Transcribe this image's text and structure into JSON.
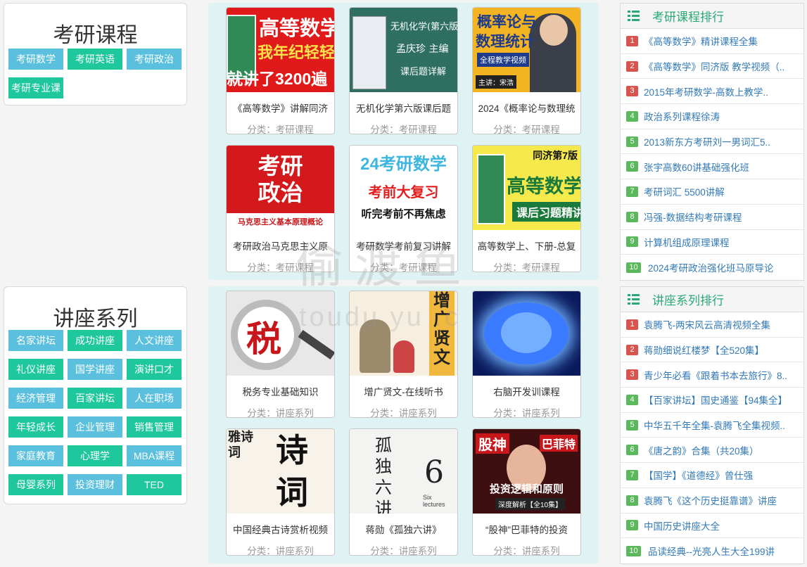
{
  "kaoyan": {
    "title": "考研课程",
    "tags": [
      "考研数学",
      "考研英语",
      "考研政治",
      "考研专业课"
    ],
    "courses": [
      {
        "title": "《高等数学》讲解同济",
        "cat": "分类：考研课程",
        "thumb": [
          "高等数学",
          "我年纪轻轻",
          "就讲了3200遍"
        ]
      },
      {
        "title": "无机化学第六版课后题",
        "cat": "分类：考研课程",
        "thumb": [
          "无机化学(第六版)",
          "孟庆珍 主编",
          "课后题详解"
        ]
      },
      {
        "title": "2024《概率论与数理统",
        "cat": "分类：考研课程",
        "thumb": [
          "概率论与",
          "数理统计",
          "全程教学视频",
          "主讲：宋浩"
        ]
      },
      {
        "title": "考研政治马克思主义原",
        "cat": "分类：考研课程",
        "thumb": [
          "考研",
          "政治",
          "马克思主义基本原理概论"
        ]
      },
      {
        "title": "考研数学考前复习讲解",
        "cat": "分类：考研课程",
        "thumb": [
          "24考研数学",
          "考前大复习",
          "听完考前不再焦虑"
        ]
      },
      {
        "title": "高等数学上、下册-总复",
        "cat": "分类：考研课程",
        "thumb": [
          "同济第7版",
          "高等数学",
          "课后习题精讲"
        ]
      }
    ],
    "rank_title": "考研课程排行",
    "rank": [
      "《高等数学》精讲课程全集",
      "《高等数学》同济版 教学视频（..",
      "2015年考研数学-高数上教学..",
      "政治系列课程徐涛",
      "2013新东方考研刘一男词汇5..",
      "张宇高数60讲基础强化班",
      "考研词汇 5500讲解",
      "冯强-数据结构考研课程",
      "计算机组成原理课程",
      "2024考研政治强化班马原导论"
    ]
  },
  "lecture": {
    "title": "讲座系列",
    "tags": [
      "名家讲坛",
      "成功讲座",
      "人文讲座",
      "礼仪讲座",
      "国学讲座",
      "演讲口才",
      "经济管理",
      "百家讲坛",
      "人在职场",
      "年轻成长",
      "企业管理",
      "销售管理",
      "家庭教育",
      "心理学",
      "MBA课程",
      "母婴系列",
      "投资理财",
      "TED"
    ],
    "courses": [
      {
        "title": "税务专业基础知识",
        "cat": "分类：讲座系列",
        "thumb": [
          "税"
        ]
      },
      {
        "title": "增广贤文-在线听书",
        "cat": "分类：讲座系列",
        "thumb": [
          "增广贤文"
        ]
      },
      {
        "title": "右脑开发训课程",
        "cat": "分类：讲座系列",
        "thumb": []
      },
      {
        "title": "中国经典古诗赏析视频",
        "cat": "分类：讲座系列",
        "thumb": [
          "诗词",
          "雅诗词"
        ]
      },
      {
        "title": "蒋勋《孤独六讲》",
        "cat": "分类：讲座系列",
        "thumb": [
          "孤独六讲",
          "6",
          "Six lectures"
        ]
      },
      {
        "title": "“股神”巴菲特的投资",
        "cat": "分类：讲座系列",
        "thumb": [
          "股神",
          "巴菲特",
          "投资逻辑和原则",
          "深度解析【全10集】"
        ]
      }
    ],
    "rank_title": "讲座系列排行",
    "rank": [
      "袁腾飞-两宋风云高清视频全集",
      "蒋勋细说红楼梦【全520集】",
      "青少年必看《跟着书本去旅行》8..",
      "【百家讲坛】国史通鉴【94集全】",
      "中华五千年全集-袁腾飞全集视频..",
      "《唐之韵》合集（共20集）",
      "【国学】《道德经》曾仕强",
      "袁腾飞《这个历史挺靠谱》讲座",
      "中国历史讲座大全",
      "品读经典--光亮人生大全199讲"
    ]
  },
  "rank_numbers": [
    "1",
    "2",
    "3",
    "4",
    "5",
    "6",
    "7",
    "8",
    "9",
    "10"
  ],
  "watermark": {
    "main": "偷渡鱼",
    "sub": "toudu yu .c"
  },
  "colors": {
    "tag_blue": "#5bc0de",
    "tag_green": "#1ec79c",
    "rank_red": "#d9534f",
    "rank_green": "#5cb85c",
    "accent": "#2aa878",
    "link": "#337ab7"
  }
}
